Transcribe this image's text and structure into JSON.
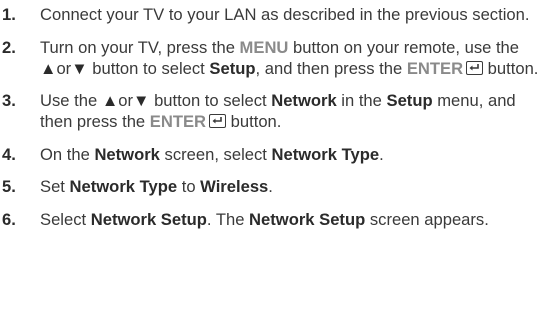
{
  "steps": [
    {
      "number": "1.",
      "segments": [
        {
          "type": "text",
          "text": "Connect your TV to your LAN as described in the previous section."
        }
      ]
    },
    {
      "number": "2.",
      "segments": [
        {
          "type": "text",
          "text": "Turn on your TV, press the "
        },
        {
          "type": "key",
          "text": "MENU"
        },
        {
          "type": "text",
          "text": " button on your remote, use the "
        },
        {
          "type": "arrow",
          "text": "▲"
        },
        {
          "type": "text",
          "text": "or"
        },
        {
          "type": "arrow",
          "text": "▼"
        },
        {
          "type": "text",
          "text": " button to select "
        },
        {
          "type": "bold",
          "text": "Setup"
        },
        {
          "type": "text",
          "text": ", and then press the "
        },
        {
          "type": "key",
          "text": "ENTER"
        },
        {
          "type": "icon",
          "icon": "enter-icon"
        },
        {
          "type": "text",
          "text": " button."
        }
      ]
    },
    {
      "number": "3.",
      "segments": [
        {
          "type": "text",
          "text": "Use the "
        },
        {
          "type": "arrow",
          "text": "▲"
        },
        {
          "type": "text",
          "text": "or"
        },
        {
          "type": "arrow",
          "text": "▼"
        },
        {
          "type": "text",
          "text": " button to select "
        },
        {
          "type": "bold",
          "text": "Network"
        },
        {
          "type": "text",
          "text": " in the "
        },
        {
          "type": "bold",
          "text": "Setup"
        },
        {
          "type": "text",
          "text": " menu, and then press the "
        },
        {
          "type": "key",
          "text": "ENTER"
        },
        {
          "type": "icon",
          "icon": "enter-icon"
        },
        {
          "type": "text",
          "text": " button."
        }
      ]
    },
    {
      "number": "4.",
      "segments": [
        {
          "type": "text",
          "text": "On the "
        },
        {
          "type": "bold",
          "text": "Network"
        },
        {
          "type": "text",
          "text": " screen, select "
        },
        {
          "type": "bold",
          "text": "Network Type"
        },
        {
          "type": "text",
          "text": "."
        }
      ]
    },
    {
      "number": "5.",
      "segments": [
        {
          "type": "text",
          "text": "Set "
        },
        {
          "type": "bold",
          "text": "Network Type"
        },
        {
          "type": "text",
          "text": " to "
        },
        {
          "type": "bold",
          "text": "Wireless"
        },
        {
          "type": "text",
          "text": "."
        }
      ]
    },
    {
      "number": "6.",
      "segments": [
        {
          "type": "text",
          "text": "Select "
        },
        {
          "type": "bold",
          "text": "Network Setup"
        },
        {
          "type": "text",
          "text": ". The "
        },
        {
          "type": "bold",
          "text": "Network Setup"
        },
        {
          "type": "text",
          "text": " screen appears."
        }
      ]
    }
  ],
  "colors": {
    "body_text": "#3a3a3a",
    "bold_text": "#2b2b2b",
    "key_text": "#8a8a8a"
  }
}
